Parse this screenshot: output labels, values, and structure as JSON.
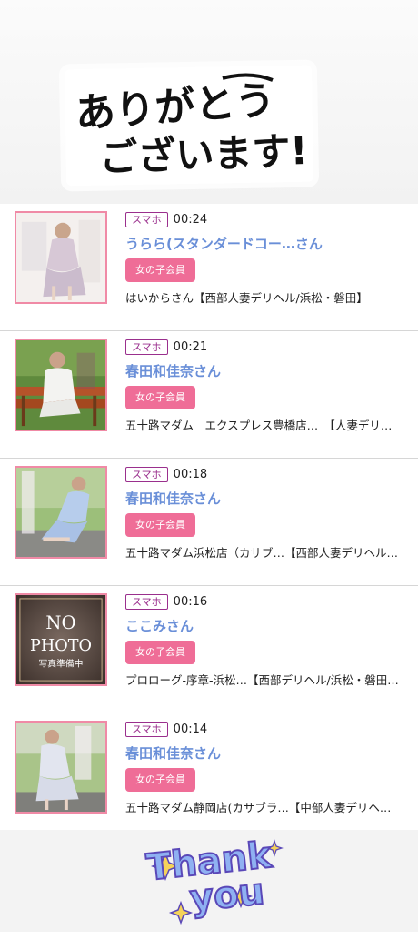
{
  "header": {
    "banner_line1": "ありがとう",
    "banner_line2": "ございます!"
  },
  "items": [
    {
      "device": "スマホ",
      "time": "00:24",
      "name": "うらら(スタンダードコー…さん",
      "member": "女の子会員",
      "shop": "はいからさん【西部人妻デリヘル/浜松・磐田】",
      "thumb": "photo-woman-1"
    },
    {
      "device": "スマホ",
      "time": "00:21",
      "name": "春田和佳奈さん",
      "member": "女の子会員",
      "shop": "五十路マダム　エクスプレス豊橋店…　【人妻デリ…",
      "thumb": "photo-woman-2"
    },
    {
      "device": "スマホ",
      "time": "00:18",
      "name": "春田和佳奈さん",
      "member": "女の子会員",
      "shop": "五十路マダム浜松店（カサブ…【西部人妻デリヘル…",
      "thumb": "photo-woman-3"
    },
    {
      "device": "スマホ",
      "time": "00:16",
      "name": "ここみさん",
      "member": "女の子会員",
      "shop": "プロローグ-序章-浜松…【西部デリヘル/浜松・磐田…",
      "thumb": "no-photo",
      "thumb_text1": "NO",
      "thumb_text2": "PHOTO",
      "thumb_text3": "写真準備中"
    },
    {
      "device": "スマホ",
      "time": "00:14",
      "name": "春田和佳奈さん",
      "member": "女の子会員",
      "shop": "五十路マダム静岡店(カサブラ…【中部人妻デリヘ…",
      "thumb": "photo-woman-4"
    }
  ],
  "footer": {
    "thank_line1": "Thank",
    "thank_line2": "you"
  },
  "colors": {
    "accent_pink": "#ef6d97",
    "name_blue": "#6a8fd8",
    "device_purple": "#9a2f8d"
  }
}
